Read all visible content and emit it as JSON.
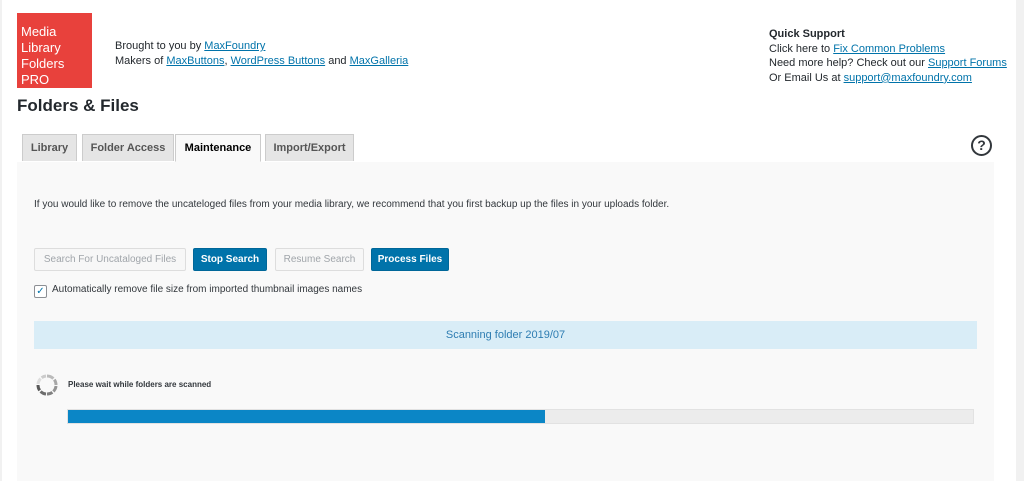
{
  "header": {
    "logo_lines": [
      "Media",
      "Library",
      "Folders PRO"
    ],
    "brought_prefix": "Brought to you by ",
    "brought_link": "MaxFoundry",
    "makers_prefix": "Makers of ",
    "makers_link1": "MaxButtons",
    "makers_sep": ", ",
    "makers_link2": "WordPress Buttons",
    "makers_and": " and ",
    "makers_link3": "MaxGalleria"
  },
  "support": {
    "title": "Quick Support",
    "line1_prefix": "Click here to ",
    "line1_link": "Fix Common Problems",
    "line2_prefix": "Need more help? Check out our ",
    "line2_link": "Support Forums",
    "line3_prefix": "Or Email Us at ",
    "line3_link": "support@maxfoundry.com"
  },
  "page_title": "Folders & Files",
  "tabs": [
    {
      "label": "Library"
    },
    {
      "label": "Folder Access"
    },
    {
      "label": "Maintenance",
      "active": true
    },
    {
      "label": "Import/Export"
    }
  ],
  "help_icon_glyph": "?",
  "maintenance": {
    "instruction": "If you would like to remove the uncateloged files from your media library, we recommend that you first backup up the files in your uploads folder.",
    "buttons": {
      "search": "Search For Uncataloged Files",
      "stop": "Stop Search",
      "resume": "Resume Search",
      "process": "Process Files"
    },
    "checkbox_label": "Automatically remove file size from imported thumbnail images names",
    "checkbox_checked": true,
    "scan_status": "Scanning folder 2019/07",
    "wait_text": "Please wait while folders are scanned",
    "progress_fraction": 0.527
  },
  "colors": {
    "accent": "#0073aa",
    "logo_bg": "#e8413c",
    "progress_fill": "#0b86c6",
    "scan_bg": "#d9edf7"
  }
}
